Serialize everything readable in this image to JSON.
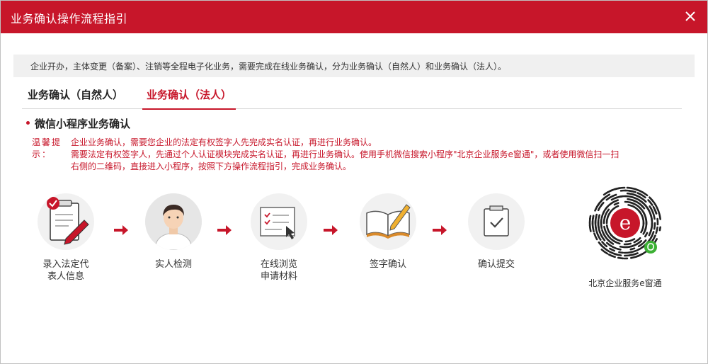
{
  "dialog": {
    "title": "业务确认操作流程指引"
  },
  "notice": {
    "text": "企业开办，主体变更（备案）、注销等全程电子化业务，需要完成在线业务确认，分为业务确认（自然人）和业务确认（法人）。"
  },
  "tabs": [
    {
      "label": "业务确认（自然人）",
      "active": false
    },
    {
      "label": "业务确认（法人）",
      "active": true
    }
  ],
  "section": {
    "title": "微信小程序业务确认"
  },
  "tip": {
    "label": "温馨提示：",
    "lines": [
      "企业业务确认，需要您企业的法定有权签字人先完成实名认证，再进行业务确认。",
      "需要法定有权签字人，先通过个人认证模块完成实名认证，再进行业务确认。使用手机微信搜索小程序\"北京企业服务e窗通\"，或者使用微信扫一扫",
      "右侧的二维码，直接进入小程序，按照下方操作流程指引，完成业务确认。"
    ]
  },
  "steps": [
    {
      "label_line1": "录入法定代",
      "label_line2": "表人信息",
      "icon": "clipboard-check-pen-icon"
    },
    {
      "label_line1": "实人检测",
      "label_line2": "",
      "icon": "person-avatar-icon"
    },
    {
      "label_line1": "在线浏览",
      "label_line2": "申请材料",
      "icon": "document-browse-cursor-icon"
    },
    {
      "label_line1": "签字确认",
      "label_line2": "",
      "icon": "open-book-pencil-icon"
    },
    {
      "label_line1": "确认提交",
      "label_line2": "",
      "icon": "checkmark-box-icon"
    }
  ],
  "qr": {
    "label": "北京企业服务e窗通",
    "logo_letter": "e"
  },
  "colors": {
    "brand_red": "#c7162a",
    "notice_bg": "#f0f0f0",
    "text": "#333333"
  }
}
